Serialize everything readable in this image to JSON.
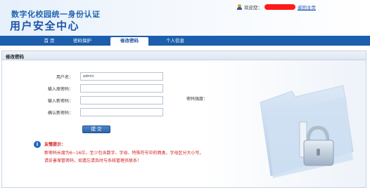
{
  "header": {
    "subtitle": "数字化校园统一身份认证",
    "title": "用户安全中心",
    "welcome": "欢迎您：",
    "home_link": "返回主页"
  },
  "nav": {
    "items": [
      {
        "label": "首 页"
      },
      {
        "label": "密码保护"
      },
      {
        "label": "修改密码"
      },
      {
        "label": "个人信息"
      }
    ],
    "active": "修改密码"
  },
  "section": {
    "title": "修改密码"
  },
  "form": {
    "username_label": "用户名：",
    "username_value": "admin",
    "old_password_label": "输入原密码：",
    "new_password_label": "输入新密码：",
    "confirm_password_label": "确认新密码：",
    "strength_label": "密码强度：",
    "submit_label": "提 交"
  },
  "tips": {
    "title": "友情提示：",
    "line1": "新密码长度为6~16位，至少包含数字、字母、特殊符号中的两类，字母区分大小写。",
    "line2": "请妥善保管密码，如遗忘请及时与系统管理员联系！"
  },
  "colors": {
    "brand": "#1c5fae",
    "title": "#1a56a5",
    "warning": "#d11a1a"
  },
  "icons": {
    "user": "user-icon",
    "info": "info-icon",
    "folder": "folder-lock-icon"
  }
}
